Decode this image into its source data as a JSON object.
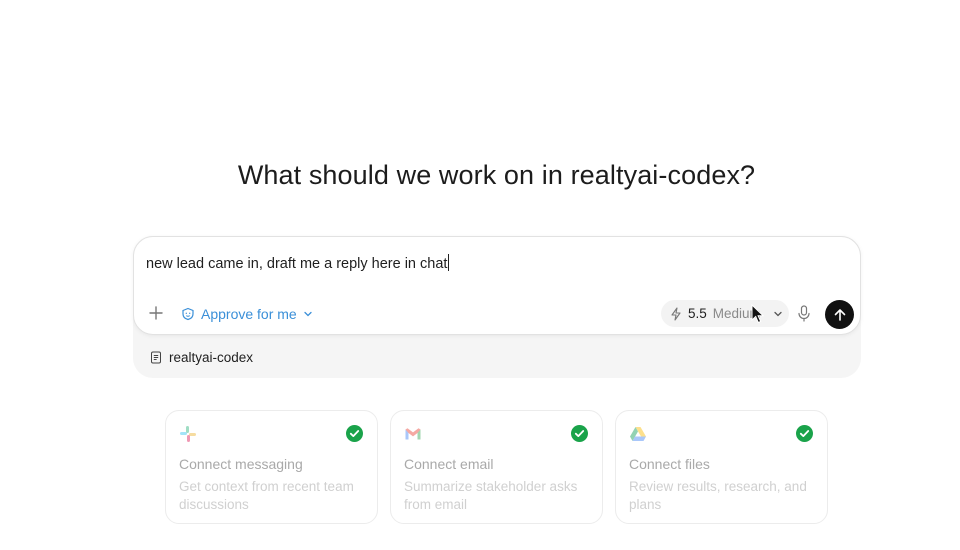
{
  "heading": "What should we work on in realtyai-codex?",
  "composer": {
    "input_value": "new lead came in, draft me a reply here in chat",
    "approval_label": "Approve for me",
    "model": {
      "version": "5.5",
      "effort": "Medium"
    }
  },
  "repo_chip": {
    "label": "realtyai-codex"
  },
  "cards": [
    {
      "icon": "slack-icon",
      "title": "Connect messaging",
      "description": "Get context from recent team discussions",
      "connected": true
    },
    {
      "icon": "gmail-icon",
      "title": "Connect email",
      "description": "Summarize stakeholder asks from email",
      "connected": true
    },
    {
      "icon": "google-drive-icon",
      "title": "Connect files",
      "description": "Review results, research, and plans",
      "connected": true
    }
  ],
  "colors": {
    "accent": "#3a8fd8",
    "check": "#1aa34a",
    "send": "#111111"
  }
}
